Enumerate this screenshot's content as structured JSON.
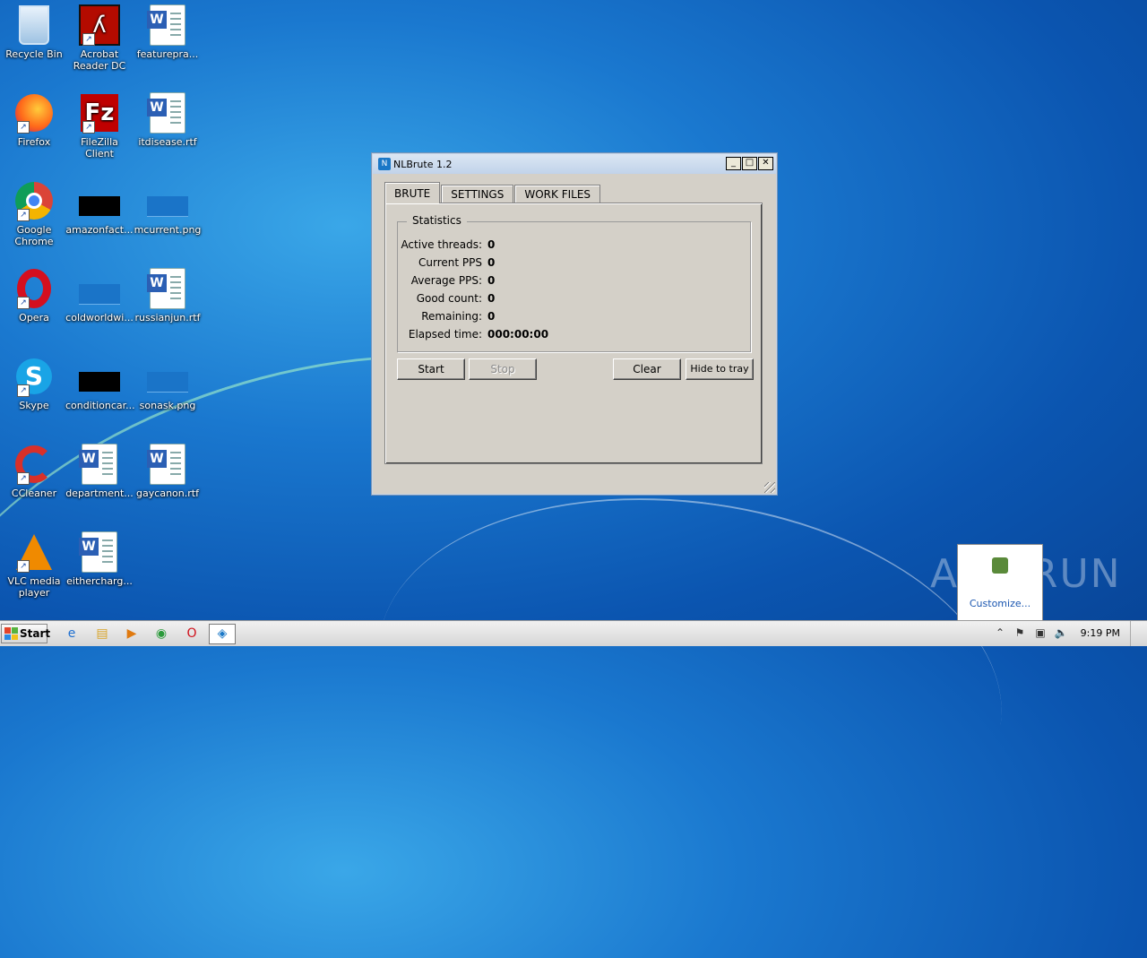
{
  "desktop": {
    "icons": [
      {
        "label": "Recycle Bin",
        "kind": "recycle-bin"
      },
      {
        "label": "Acrobat Reader DC",
        "kind": "acrobat"
      },
      {
        "label": "featurepra...",
        "kind": "word-doc"
      },
      {
        "label": "Firefox",
        "kind": "firefox"
      },
      {
        "label": "FileZilla Client",
        "kind": "filezilla"
      },
      {
        "label": "itdisease.rtf",
        "kind": "word-doc"
      },
      {
        "label": "Google Chrome",
        "kind": "chrome"
      },
      {
        "label": "amazonfact...",
        "kind": "black-image"
      },
      {
        "label": "mcurrent.png",
        "kind": "blue-image"
      },
      {
        "label": "Opera",
        "kind": "opera"
      },
      {
        "label": "coldworldwi...",
        "kind": "blue-image"
      },
      {
        "label": "russianjun.rtf",
        "kind": "word-doc"
      },
      {
        "label": "Skype",
        "kind": "skype"
      },
      {
        "label": "conditioncar...",
        "kind": "black-image"
      },
      {
        "label": "sonask.png",
        "kind": "blue-image"
      },
      {
        "label": "CCleaner",
        "kind": "ccleaner"
      },
      {
        "label": "department...",
        "kind": "word-doc"
      },
      {
        "label": "gaycanon.rtf",
        "kind": "word-doc"
      },
      {
        "label": "VLC media player",
        "kind": "vlc"
      },
      {
        "label": "eithercharg...",
        "kind": "word-doc"
      }
    ]
  },
  "window": {
    "title": "NLBrute 1.2",
    "controls": {
      "minimize": "_",
      "maximize": "□",
      "close": "✕"
    },
    "tabs": [
      {
        "label": "BRUTE",
        "active": true
      },
      {
        "label": "SETTINGS",
        "active": false
      },
      {
        "label": "WORK FILES",
        "active": false
      }
    ],
    "statistics": {
      "legend": "Statistics",
      "rows": [
        {
          "label": "Active threads:",
          "value": "0"
        },
        {
          "label": "Current PPS",
          "value": "0"
        },
        {
          "label": "Average PPS:",
          "value": "0"
        },
        {
          "label": "Good count:",
          "value": "0"
        },
        {
          "label": "Remaining:",
          "value": "0"
        },
        {
          "label": "Elapsed time:",
          "value": "000:00:00"
        }
      ]
    },
    "buttons": {
      "start": "Start",
      "stop": "Stop",
      "clear": "Clear",
      "hide": "Hide to tray"
    }
  },
  "taskbar": {
    "start_label": "Start",
    "clock": "9:19 PM",
    "tray_popup_link": "Customize...",
    "watermark": "ANY RUN"
  }
}
